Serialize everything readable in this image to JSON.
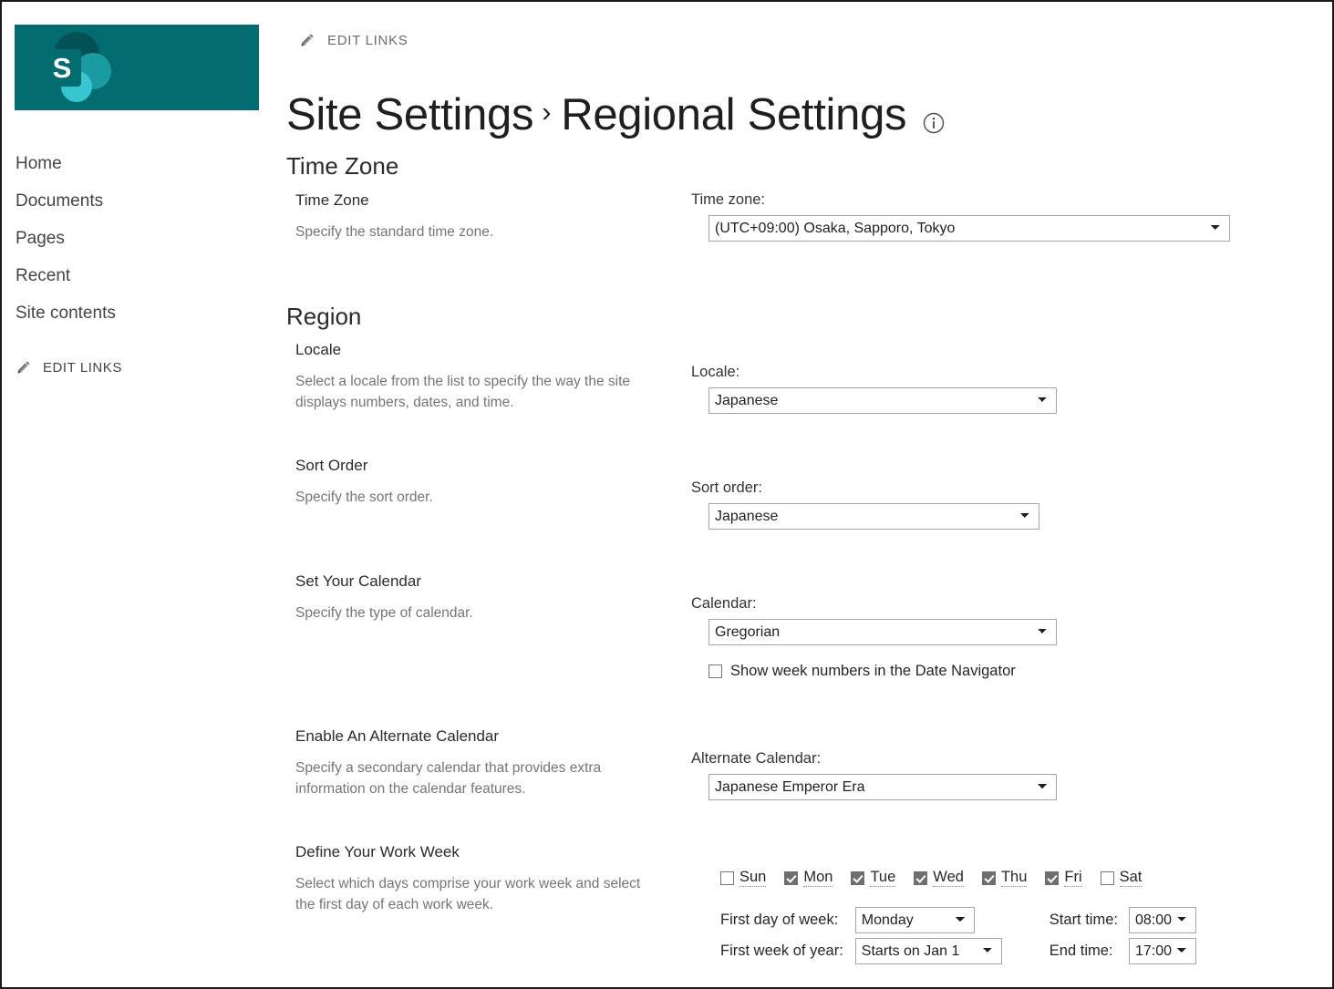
{
  "brand": {
    "logo_letter": "S",
    "logo_bg": "#036C70",
    "logo_dark_circle": "#025155",
    "logo_mid_circle": "#1A9BA1",
    "logo_bright_circle": "#37C6D0",
    "logo_tile": "#09787C"
  },
  "sidebar": {
    "items": [
      {
        "label": "Home"
      },
      {
        "label": "Documents"
      },
      {
        "label": "Pages"
      },
      {
        "label": "Recent"
      },
      {
        "label": "Site contents"
      }
    ],
    "edit_links": "EDIT LINKS",
    "edit_links_icon": "pencil-icon"
  },
  "header": {
    "edit_links": "EDIT LINKS",
    "edit_links_icon": "pencil-icon",
    "title_parent": "Site Settings",
    "title_separator": "›",
    "title_current": "Regional Settings",
    "info_icon": "info-icon"
  },
  "sections": {
    "time_zone": {
      "heading": "Time Zone",
      "item": {
        "title": "Time Zone",
        "description": "Specify the standard time zone.",
        "field_label": "Time zone:",
        "value": "(UTC+09:00) Osaka, Sapporo, Tokyo",
        "options": [
          "(UTC+09:00) Osaka, Sapporo, Tokyo"
        ]
      }
    },
    "region": {
      "heading": "Region",
      "locale": {
        "title": "Locale",
        "description": "Select a locale from the list to specify the way the site displays numbers, dates, and time.",
        "field_label": "Locale:",
        "value": "Japanese",
        "options": [
          "Japanese"
        ]
      },
      "sort_order": {
        "title": "Sort Order",
        "description": "Specify the sort order.",
        "field_label": "Sort order:",
        "value": "Japanese",
        "options": [
          "Japanese"
        ]
      },
      "calendar": {
        "title": "Set Your Calendar",
        "description": "Specify the type of calendar.",
        "field_label": "Calendar:",
        "value": "Gregorian",
        "options": [
          "Gregorian"
        ],
        "week_numbers_label": "Show week numbers in the Date Navigator",
        "week_numbers_checked": false
      },
      "alternate_calendar": {
        "title": "Enable An Alternate Calendar",
        "description": "Specify a secondary calendar that provides extra information on the calendar features.",
        "field_label": "Alternate Calendar:",
        "value": "Japanese Emperor Era",
        "options": [
          "Japanese Emperor Era"
        ]
      },
      "work_week": {
        "title": "Define Your Work Week",
        "description": "Select which days comprise your work week and select the first day of each work week.",
        "days": [
          {
            "label": "Sun",
            "checked": false
          },
          {
            "label": "Mon",
            "checked": true
          },
          {
            "label": "Tue",
            "checked": true
          },
          {
            "label": "Wed",
            "checked": true
          },
          {
            "label": "Thu",
            "checked": true
          },
          {
            "label": "Fri",
            "checked": true
          },
          {
            "label": "Sat",
            "checked": false
          }
        ],
        "first_day_label": "First day of week:",
        "first_day_value": "Monday",
        "first_day_options": [
          "Monday"
        ],
        "first_week_label": "First week of year:",
        "first_week_value": "Starts on Jan 1",
        "first_week_options": [
          "Starts on Jan 1"
        ],
        "start_time_label": "Start time:",
        "start_time_value": "08:00",
        "start_time_options": [
          "08:00"
        ],
        "end_time_label": "End time:",
        "end_time_value": "17:00",
        "end_time_options": [
          "17:00"
        ]
      }
    }
  }
}
